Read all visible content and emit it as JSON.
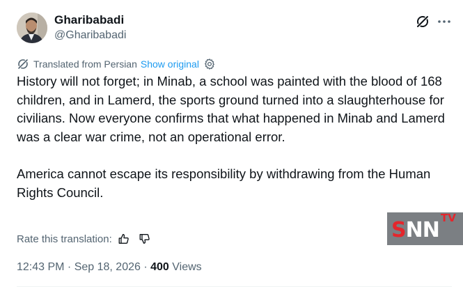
{
  "author": {
    "display_name": "Gharibabadi",
    "handle": "@Gharibabadi"
  },
  "translation": {
    "label": "Translated from Persian",
    "show_original": "Show original"
  },
  "tweet": {
    "paragraphs": [
      "History will not forget; in Minab, a school was painted with the blood of 168 children, and in Lamerd, the sports ground turned into a slaughterhouse for civilians. Now everyone confirms that what happened in Minab and Lamerd was a clear war crime, not an operational error.",
      "America cannot escape its responsibility by withdrawing from the Human Rights Council."
    ]
  },
  "rate": {
    "label": "Rate this translation:"
  },
  "meta": {
    "time_date": "12:43 PM · Sep 18, 2026 · ",
    "views_count": "400",
    "views_label": " Views"
  },
  "watermark": {
    "main_s": "S",
    "main_rest": "NN",
    "tv": "TV"
  },
  "icons": {
    "grok": "grok-icon",
    "more": "more-icon",
    "translate": "translate-icon",
    "gear": "gear-icon",
    "thumbs_up": "thumbs-up-icon",
    "thumbs_down": "thumbs-down-icon"
  },
  "colors": {
    "text": "#0f1419",
    "secondary": "#536471",
    "link": "#1d9bf0",
    "watermark_bg": "#7b7f83",
    "watermark_red": "#e4262c"
  }
}
